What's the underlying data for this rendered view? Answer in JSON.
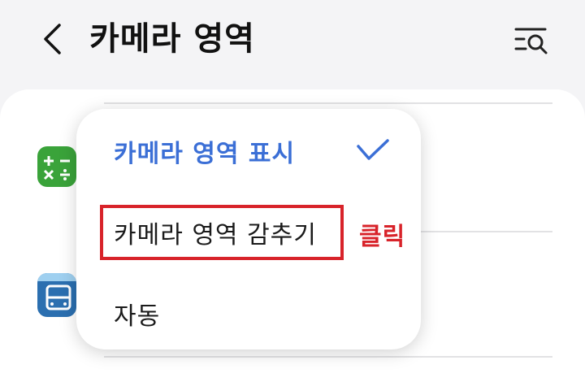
{
  "header": {
    "title": "카메라 영역",
    "back_icon": "chevron-left-icon",
    "search_icon": "list-search-icon"
  },
  "menu": {
    "items": [
      {
        "label": "카메라 영역 표시",
        "selected": true
      },
      {
        "label": "카메라 영역 감추기",
        "selected": false
      },
      {
        "label": "자동",
        "selected": false
      }
    ],
    "selected_color": "#3b6fd6",
    "check_icon": "check-icon"
  },
  "annotation": {
    "text": "클릭",
    "color": "#d8232a"
  },
  "apps": {
    "calculator_icon": "calculator-app-icon",
    "bus_icon": "bus-app-icon"
  }
}
